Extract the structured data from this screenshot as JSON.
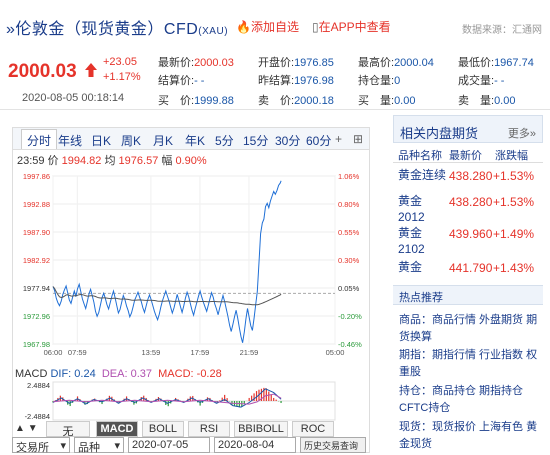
{
  "header": {
    "title": "伦敦金（现货黄金）CFD",
    "symbol": "(XAU)",
    "favorite_label": "添加自选",
    "app_label": "在APP中查看",
    "source": "数据来源：汇通网"
  },
  "quote": {
    "last": "2000.03",
    "change": "+23.05",
    "change_pct": "+1.17%",
    "timestamp": "2020-08-05 00:18:14",
    "fields": [
      {
        "label": "最新价:",
        "value": "2000.03",
        "red": true
      },
      {
        "label": "开盘价:",
        "value": "1976.85",
        "red": false
      },
      {
        "label": "最高价:",
        "value": "2000.04",
        "red": false
      },
      {
        "label": "最低价:",
        "value": "1967.74",
        "red": false
      },
      {
        "label": "结算价:",
        "value": "- -",
        "red": false
      },
      {
        "label": "昨结算:",
        "value": "1976.98",
        "red": false
      },
      {
        "label": "持仓量:",
        "value": "0",
        "red": false
      },
      {
        "label": "成交量:",
        "value": "- -",
        "red": false
      },
      {
        "label": "买　价:",
        "value": "1999.88",
        "red": false
      },
      {
        "label": "卖　价:",
        "value": "2000.18",
        "red": false
      },
      {
        "label": "买　量:",
        "value": "0.00",
        "red": false
      },
      {
        "label": "卖　量:",
        "value": "0.00",
        "red": false
      }
    ]
  },
  "chart_tabs": [
    "分时",
    "年线",
    "日K",
    "周K",
    "月K",
    "年K",
    "5分",
    "15分",
    "30分",
    "60分"
  ],
  "chart_info": {
    "time": "23:59",
    "price_label": "价",
    "price": "1994.82",
    "avg_label": "均",
    "avg": "1976.57",
    "range_label": "幅",
    "range": "0.90%"
  },
  "chart_data": {
    "type": "line",
    "title": "",
    "x_ticks": [
      "06:00",
      "07:59",
      "13:59",
      "17:59",
      "21:59",
      "05:00"
    ],
    "y_ticks_left": [
      "1997.86",
      "1992.88",
      "1987.90",
      "1982.92",
      "1977.94",
      "1972.96",
      "1967.98"
    ],
    "y_ticks_right": [
      "1.06%",
      "0.80%",
      "0.55%",
      "0.30%",
      "0.05%",
      "-0.20%",
      "-0.46%"
    ],
    "ylim": [
      1967.98,
      1997.86
    ],
    "reference_price": 1976.98,
    "x_range_minutes": [
      0,
      1380
    ],
    "series": [
      {
        "values": [
          [
            0,
            1978.2
          ],
          [
            8,
            1977.5
          ],
          [
            16,
            1976.1
          ],
          [
            24,
            1975.3
          ],
          [
            32,
            1974.8
          ],
          [
            40,
            1975.6
          ],
          [
            48,
            1976.8
          ],
          [
            56,
            1977.6
          ],
          [
            64,
            1978.3
          ],
          [
            72,
            1977.1
          ],
          [
            80,
            1975.8
          ],
          [
            88,
            1975.2
          ],
          [
            96,
            1976.3
          ],
          [
            104,
            1977.4
          ],
          [
            112,
            1976.4
          ],
          [
            120,
            1977.8
          ],
          [
            128,
            1978.6
          ],
          [
            136,
            1977.3
          ],
          [
            144,
            1976.0
          ],
          [
            152,
            1975.1
          ],
          [
            160,
            1974.3
          ],
          [
            168,
            1975.5
          ],
          [
            176,
            1976.9
          ],
          [
            184,
            1977.7
          ],
          [
            192,
            1976.6
          ],
          [
            200,
            1975.4
          ],
          [
            208,
            1973.8
          ],
          [
            216,
            1972.9
          ],
          [
            224,
            1973.6
          ],
          [
            232,
            1974.9
          ],
          [
            240,
            1976.2
          ],
          [
            248,
            1977.0
          ],
          [
            256,
            1976.1
          ],
          [
            264,
            1975.0
          ],
          [
            272,
            1974.2
          ],
          [
            280,
            1975.3
          ],
          [
            288,
            1976.5
          ],
          [
            296,
            1977.4
          ],
          [
            304,
            1976.2
          ],
          [
            312,
            1974.8
          ],
          [
            320,
            1973.5
          ],
          [
            328,
            1974.1
          ],
          [
            336,
            1975.4
          ],
          [
            344,
            1976.6
          ],
          [
            352,
            1975.9
          ],
          [
            360,
            1974.7
          ],
          [
            368,
            1973.9
          ],
          [
            376,
            1972.8
          ],
          [
            384,
            1973.5
          ],
          [
            392,
            1974.6
          ],
          [
            400,
            1975.8
          ],
          [
            408,
            1976.5
          ],
          [
            416,
            1977.2
          ],
          [
            424,
            1976.3
          ],
          [
            432,
            1975.5
          ],
          [
            440,
            1974.4
          ],
          [
            448,
            1973.6
          ],
          [
            456,
            1974.8
          ],
          [
            464,
            1975.9
          ],
          [
            472,
            1976.7
          ],
          [
            480,
            1975.9
          ],
          [
            488,
            1974.9
          ],
          [
            496,
            1973.8
          ],
          [
            504,
            1973.0
          ],
          [
            512,
            1972.3
          ],
          [
            520,
            1973.3
          ],
          [
            528,
            1974.6
          ],
          [
            536,
            1975.7
          ],
          [
            544,
            1976.6
          ],
          [
            552,
            1977.4
          ],
          [
            560,
            1976.5
          ],
          [
            568,
            1975.6
          ],
          [
            576,
            1974.5
          ],
          [
            584,
            1973.5
          ],
          [
            592,
            1974.4
          ],
          [
            600,
            1975.6
          ],
          [
            608,
            1976.8
          ],
          [
            616,
            1975.7
          ],
          [
            624,
            1974.6
          ],
          [
            632,
            1973.6
          ],
          [
            640,
            1974.8
          ],
          [
            648,
            1976.1
          ],
          [
            656,
            1977.2
          ],
          [
            664,
            1976.4
          ],
          [
            672,
            1975.2
          ],
          [
            680,
            1974.0
          ],
          [
            688,
            1973.1
          ],
          [
            696,
            1974.3
          ],
          [
            704,
            1975.4
          ],
          [
            712,
            1976.5
          ],
          [
            720,
            1977.4
          ],
          [
            728,
            1976.3
          ],
          [
            736,
            1975.4
          ],
          [
            744,
            1974.6
          ],
          [
            752,
            1973.8
          ],
          [
            760,
            1974.9
          ],
          [
            768,
            1976.0
          ],
          [
            776,
            1977.1
          ],
          [
            784,
            1976.3
          ],
          [
            792,
            1975.1
          ],
          [
            800,
            1974.2
          ],
          [
            808,
            1973.2
          ],
          [
            816,
            1974.4
          ],
          [
            824,
            1975.5
          ],
          [
            832,
            1976.6
          ],
          [
            840,
            1975.5
          ],
          [
            848,
            1974.2
          ],
          [
            856,
            1972.9
          ],
          [
            864,
            1971.3
          ],
          [
            872,
            1970.2
          ],
          [
            880,
            1971.4
          ],
          [
            888,
            1972.8
          ],
          [
            896,
            1974.0
          ],
          [
            904,
            1972.6
          ],
          [
            912,
            1970.8
          ],
          [
            920,
            1969.3
          ],
          [
            928,
            1968.2
          ],
          [
            936,
            1970.1
          ],
          [
            944,
            1972.4
          ],
          [
            952,
            1974.3
          ],
          [
            960,
            1972.7
          ],
          [
            968,
            1971.2
          ],
          [
            976,
            1970.4
          ],
          [
            984,
            1972.6
          ],
          [
            992,
            1975.0
          ],
          [
            1000,
            1977.3
          ],
          [
            1008,
            1982.5
          ],
          [
            1016,
            1987.6
          ],
          [
            1024,
            1989.5
          ],
          [
            1032,
            1990.2
          ],
          [
            1040,
            1992.4
          ],
          [
            1048,
            1993.0
          ],
          [
            1056,
            1992.2
          ],
          [
            1064,
            1993.4
          ],
          [
            1072,
            1994.3
          ],
          [
            1080,
            1995.1
          ],
          [
            1088,
            1994.6
          ],
          [
            1096,
            1995.3
          ],
          [
            1104,
            1996.2
          ],
          [
            1112,
            1996.6
          ],
          [
            1116,
            1997.0
          ]
        ]
      }
    ],
    "macd": {
      "label": "MACD",
      "dif_label": "DIF:",
      "dif": "0.24",
      "dea_label": "DEA:",
      "dea": "0.37",
      "macd_label": "MACD:",
      "macd_value": "-0.28",
      "y_ticks": [
        "2.4884",
        "-2.4884"
      ],
      "ylim": [
        -2.4884,
        2.4884
      ],
      "dif_series": [
        [
          0,
          -0.2
        ],
        [
          40,
          0.4
        ],
        [
          80,
          -0.3
        ],
        [
          120,
          0.3
        ],
        [
          160,
          -0.4
        ],
        [
          200,
          0.2
        ],
        [
          240,
          -0.1
        ],
        [
          280,
          0.4
        ],
        [
          320,
          -0.3
        ],
        [
          360,
          0.3
        ],
        [
          400,
          -0.2
        ],
        [
          440,
          0.4
        ],
        [
          480,
          -0.2
        ],
        [
          520,
          0.3
        ],
        [
          560,
          -0.3
        ],
        [
          600,
          0.2
        ],
        [
          640,
          -0.2
        ],
        [
          680,
          0.4
        ],
        [
          720,
          -0.2
        ],
        [
          760,
          0.3
        ],
        [
          800,
          -0.3
        ],
        [
          840,
          0.2
        ],
        [
          880,
          -0.6
        ],
        [
          920,
          -0.8
        ],
        [
          960,
          -0.2
        ],
        [
          1000,
          0.6
        ],
        [
          1040,
          1.6
        ],
        [
          1080,
          1.1
        ],
        [
          1116,
          0.24
        ]
      ],
      "dea_series": [
        [
          0,
          -0.1
        ],
        [
          80,
          0.1
        ],
        [
          160,
          -0.1
        ],
        [
          240,
          0.1
        ],
        [
          320,
          -0.1
        ],
        [
          400,
          0.1
        ],
        [
          480,
          -0.1
        ],
        [
          560,
          0.1
        ],
        [
          640,
          -0.1
        ],
        [
          720,
          0.1
        ],
        [
          800,
          -0.1
        ],
        [
          880,
          -0.3
        ],
        [
          960,
          -0.4
        ],
        [
          1000,
          -0.1
        ],
        [
          1040,
          0.7
        ],
        [
          1080,
          0.9
        ],
        [
          1116,
          0.37
        ]
      ]
    }
  },
  "indicator_tabs": [
    "无",
    "MACD",
    "BOLL",
    "RSI",
    "BBIBOLL",
    "ROC"
  ],
  "indicator_active": "MACD",
  "bottom_bar": {
    "exchange": "交易所",
    "variety": "品种",
    "date_from": "2020-07-05",
    "date_to": "2020-08-04",
    "query_label": "历史交易查询"
  },
  "related": {
    "title": "相关内盘期货",
    "more": "更多»",
    "columns": [
      "品种名称",
      "最新价",
      "涨跌幅"
    ],
    "rows": [
      {
        "name": "黄金连续",
        "price": "438.280",
        "change": "+1.53%"
      },
      {
        "name": "黄金2012",
        "price": "438.280",
        "change": "+1.53%"
      },
      {
        "name": "黄金2102",
        "price": "439.960",
        "change": "+1.49%"
      },
      {
        "name": "黄金",
        "price": "441.790",
        "change": "+1.43%"
      }
    ]
  },
  "hot": {
    "title": "热点推荐",
    "items": [
      "商品：商品行情 外盘期货 期货换算",
      "期指：期指行情 行业指数 权重股",
      "持仓：商品持仓 期指持仓 CFTC持仓",
      "现货：现货报价 上海有色 黄金现货"
    ]
  },
  "colors": {
    "up": "#e5332a",
    "down": "#2a9a3a",
    "link": "#1a56a8",
    "price_line": "#1f6fd6",
    "avg_line": "#555555"
  }
}
